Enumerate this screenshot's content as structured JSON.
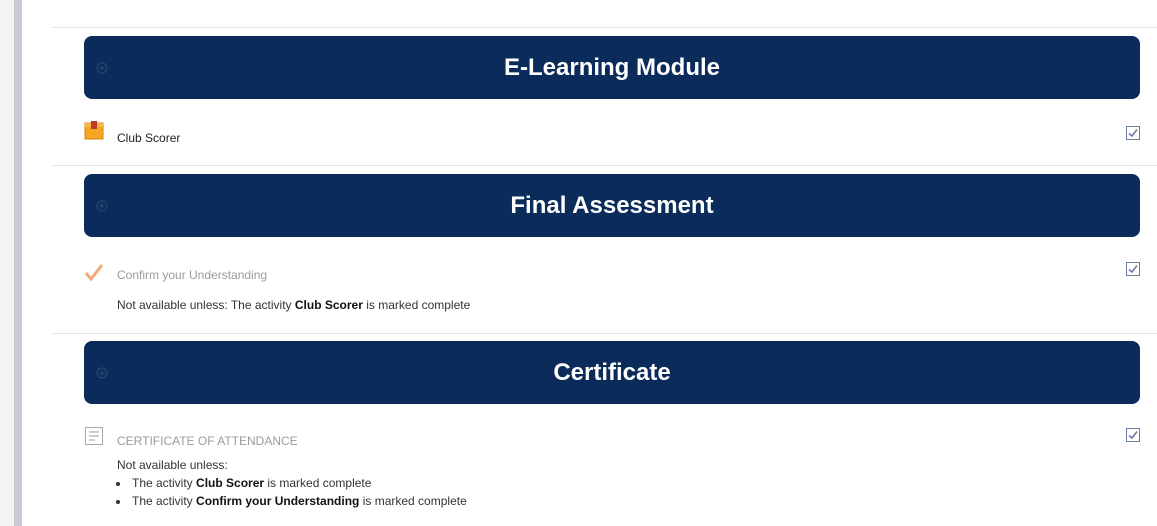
{
  "sections": [
    {
      "title": "E-Learning Module",
      "activity": {
        "name": "Club Scorer",
        "icon": "package-icon"
      }
    },
    {
      "title": "Final Assessment",
      "activity": {
        "name": "Confirm your Understanding",
        "icon": "checkmark-icon",
        "restriction": {
          "prefix": "Not available unless: The activity ",
          "activity": "Club Scorer",
          "suffix": " is marked complete"
        }
      }
    },
    {
      "title": "Certificate",
      "activity": {
        "name": "CERTIFICATE OF ATTENDANCE",
        "icon": "certificate-icon",
        "restriction": {
          "heading": "Not available unless:",
          "items": [
            {
              "prefix": "The activity ",
              "activity": "Club Scorer",
              "suffix": " is marked complete"
            },
            {
              "prefix": "The activity ",
              "activity": "Confirm your Understanding",
              "suffix": " is marked complete"
            }
          ]
        }
      }
    }
  ],
  "colors": {
    "header_bg": "#0b2b5a",
    "header_text": "#ffffff",
    "checkbox": "#6a7ba8"
  }
}
